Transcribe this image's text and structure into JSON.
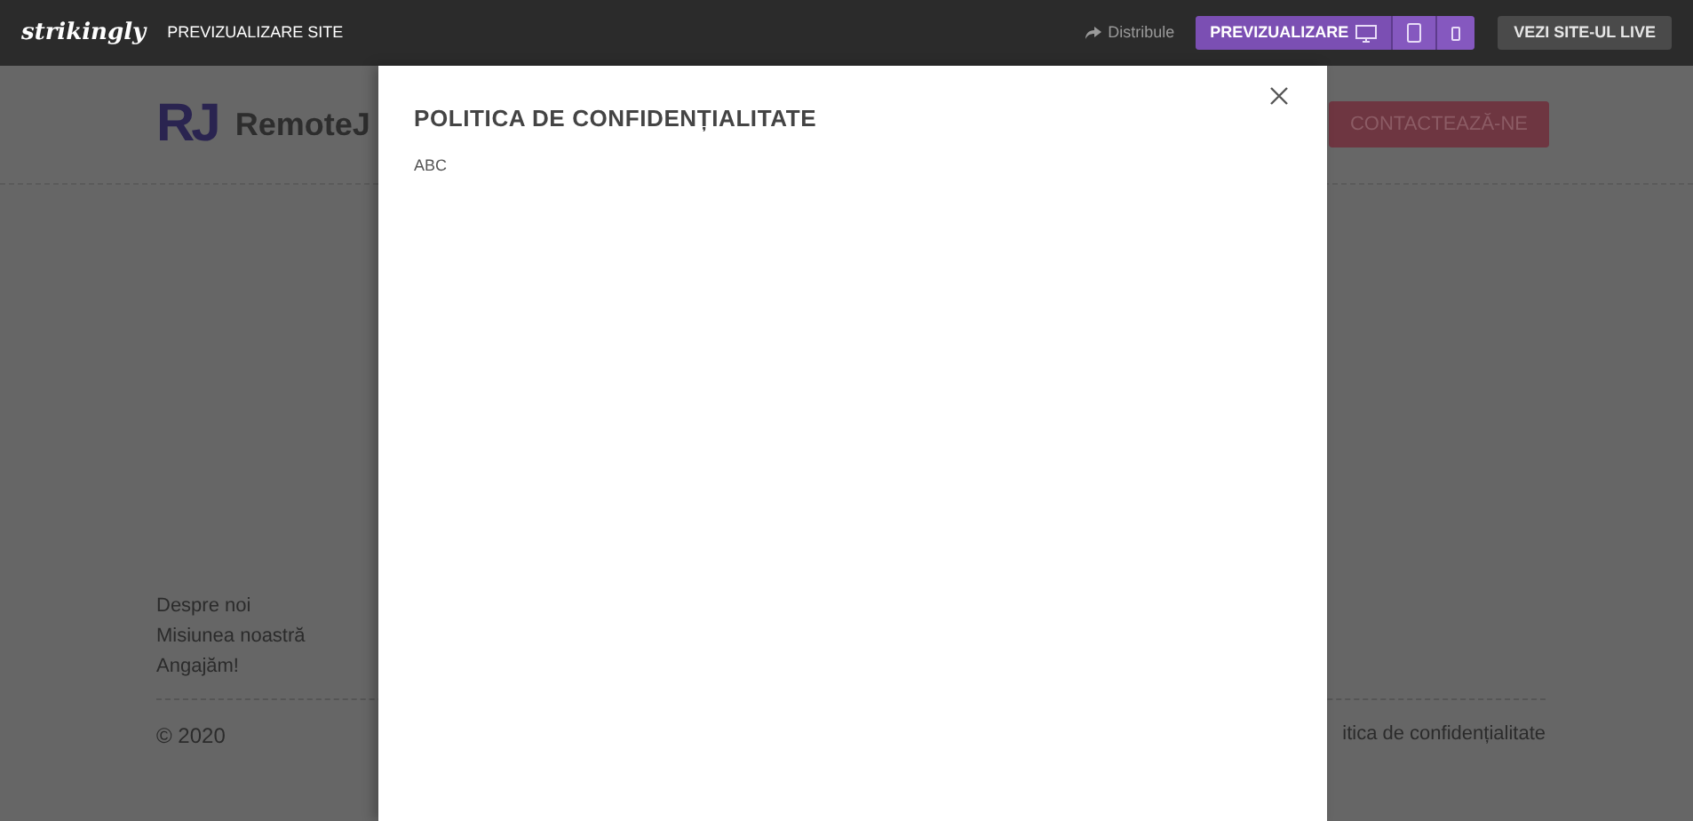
{
  "topbar": {
    "logo": "strikingly",
    "title": "PREVIZUALIZARE SITE",
    "share": "Distribule",
    "preview_label": "PREVIZUALIZARE",
    "devices": [
      {
        "kind": "desktop",
        "selected": true
      },
      {
        "kind": "tablet",
        "selected": false
      },
      {
        "kind": "phone",
        "selected": false
      }
    ],
    "live_button": "VEZI SITE-UL LIVE"
  },
  "site": {
    "logo": "RJ",
    "brand": "RemoteJ",
    "contact_button": "CONTACTEAZĂ-NE",
    "footer_links": [
      "Despre noi",
      "Misiunea noastră",
      "Angajăm!"
    ],
    "copyright": "© 2020",
    "footer_right": "itica de confidențialitate"
  },
  "modal": {
    "title": "POLITICA DE CONFIDENȚIALITATE",
    "body": "ABC"
  }
}
